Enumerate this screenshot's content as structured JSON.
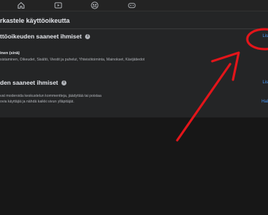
{
  "nav": {
    "icons": [
      "home-icon",
      "video-icon",
      "groups-icon",
      "gaming-icon"
    ]
  },
  "page": {
    "heading": "rkastele käyttöoikeutta"
  },
  "section1": {
    "title": "ttöoikeuden saaneet ihmiset",
    "link": "Lis",
    "person_label": "inen (sinä)",
    "permissions": "sistaminen, Oikeudet, Sisältö, Viestit ja puhelut, Yhteisötoiminta, Mainokset, Kävijätiedot"
  },
  "section2": {
    "title": "den saaneet ihmiset",
    "link": "Lis",
    "link2": "Hal",
    "desc_line1": "vat moderoida keskustelun kommentteja, jäädyttää tai poistaa",
    "desc_line2": "ovia käyttäjiä ja nähdä kaikki sivun ylläpitäjät."
  },
  "annotation": {
    "circle_color": "#e3151a",
    "arrow_color": "#e3151a"
  }
}
